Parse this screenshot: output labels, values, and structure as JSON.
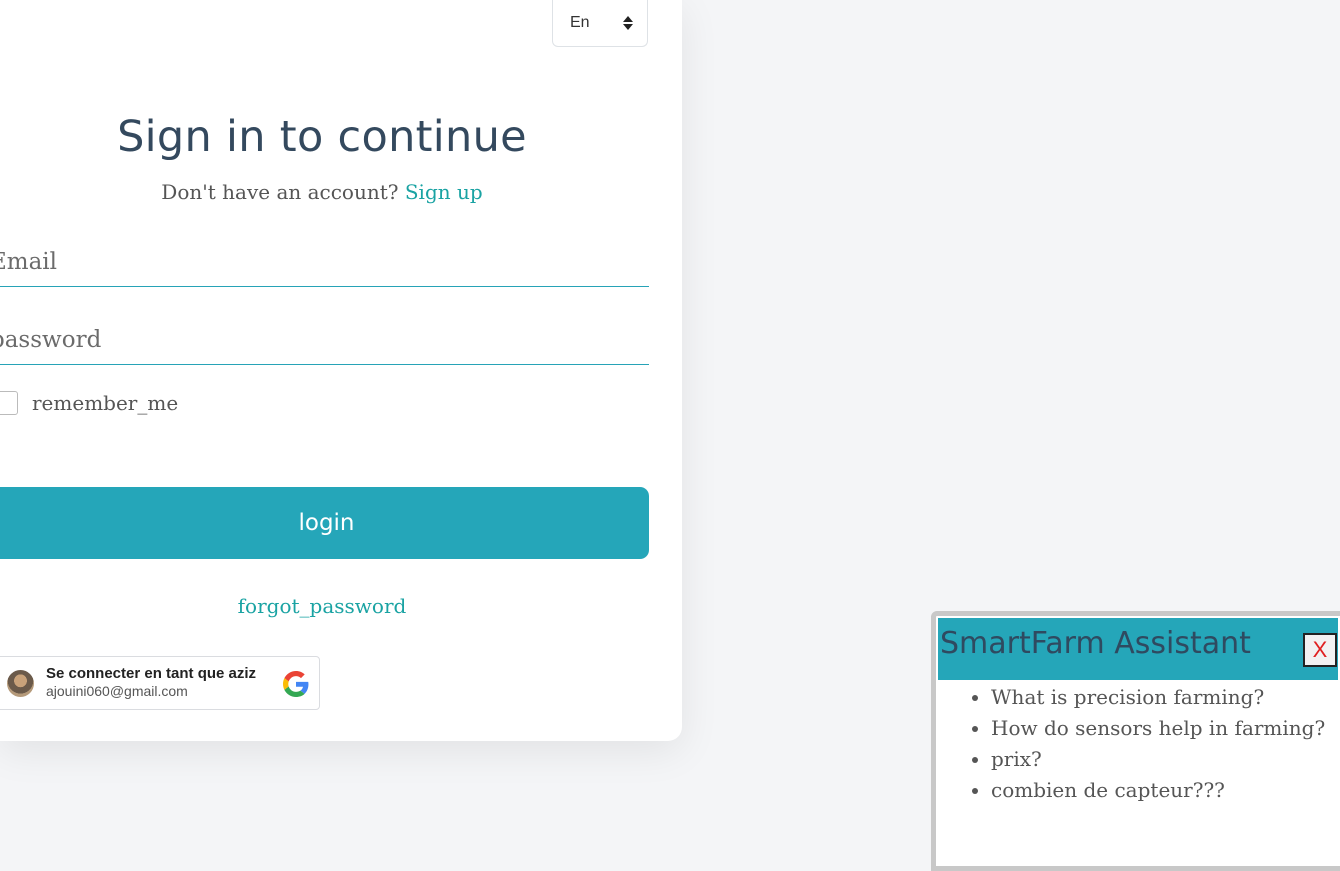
{
  "language_select": {
    "value": "En"
  },
  "login_form": {
    "title": "Sign in to continue",
    "no_account_text": "Don't have an account?",
    "signup_link": "Sign up",
    "email_placeholder": "Email",
    "password_placeholder": "password",
    "remember_label": "remember_me",
    "login_button": "login",
    "forgot_link": "forgot_password"
  },
  "google_signin": {
    "label": "Se connecter en tant que aziz",
    "email": "ajouini060@gmail.com",
    "logo_colors": {
      "blue": "#4285F4",
      "red": "#EA4335",
      "yellow": "#FBBC05",
      "green": "#34A853"
    }
  },
  "chat_widget": {
    "title": "SmartFarm Assistant",
    "close_label": "X",
    "suggestions": [
      "What is precision farming?",
      "How do sensors help in farming?",
      "prix?",
      "combien de capteur???"
    ]
  },
  "colors": {
    "accent": "#25a6b9",
    "link": "#1aa3a3",
    "title": "#34495e"
  }
}
